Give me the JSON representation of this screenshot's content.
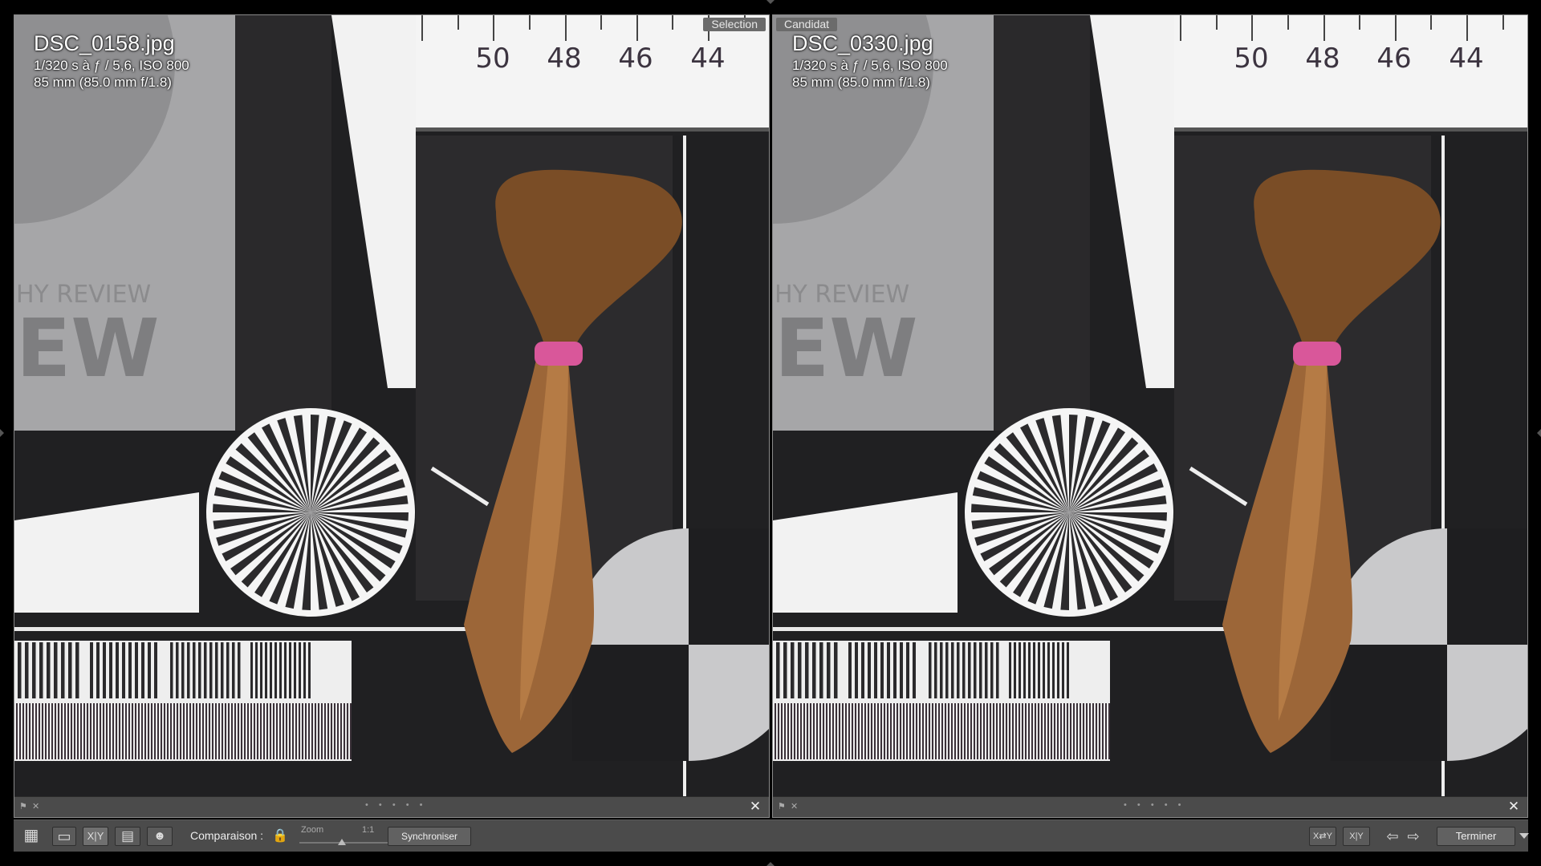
{
  "left_pane": {
    "badge": "Selection",
    "filename": "DSC_0158.jpg",
    "exposure": "1/320 s à ƒ / 5,6, ISO 800",
    "lens": "85 mm (85.0 mm f/1.8)",
    "chart_text_1": "HY REVIEW",
    "chart_text_2": "EW",
    "ruler_labels": [
      "50",
      "48",
      "46",
      "44"
    ],
    "strip_dots": "• • • • •",
    "close": "✕"
  },
  "right_pane": {
    "badge": "Candidat",
    "filename": "DSC_0330.jpg",
    "exposure": "1/320 s à ƒ / 5,6, ISO 800",
    "lens": "85 mm (85.0 mm f/1.8)",
    "chart_text_1": "HY REVIEW",
    "chart_text_2": "EW",
    "ruler_labels": [
      "50",
      "48",
      "46",
      "44"
    ],
    "strip_dots": "• • • • •",
    "close": "✕"
  },
  "toolbar": {
    "view_buttons": [
      {
        "name": "grid-view-icon",
        "glyph": "▦"
      },
      {
        "name": "loupe-view-icon",
        "glyph": "▭"
      },
      {
        "name": "compare-view-icon",
        "glyph": "X|Y"
      },
      {
        "name": "survey-view-icon",
        "glyph": "▤"
      },
      {
        "name": "people-view-icon",
        "glyph": "☻"
      }
    ],
    "compare_label": "Comparaison :",
    "zoom_label": "Zoom",
    "zoom_value": "1:1",
    "sync_label": "Synchroniser",
    "swap_glyph": "X⇄Y",
    "make_select_glyph": "X|Y",
    "prev_glyph": "⇦",
    "next_glyph": "⇨",
    "done_label": "Terminer"
  },
  "colors": {
    "hair": "#8a5a2e",
    "hair_tie": "#d9579a",
    "chart_gray": "#9c9c9e",
    "chart_dark": "#2b2a2c"
  }
}
